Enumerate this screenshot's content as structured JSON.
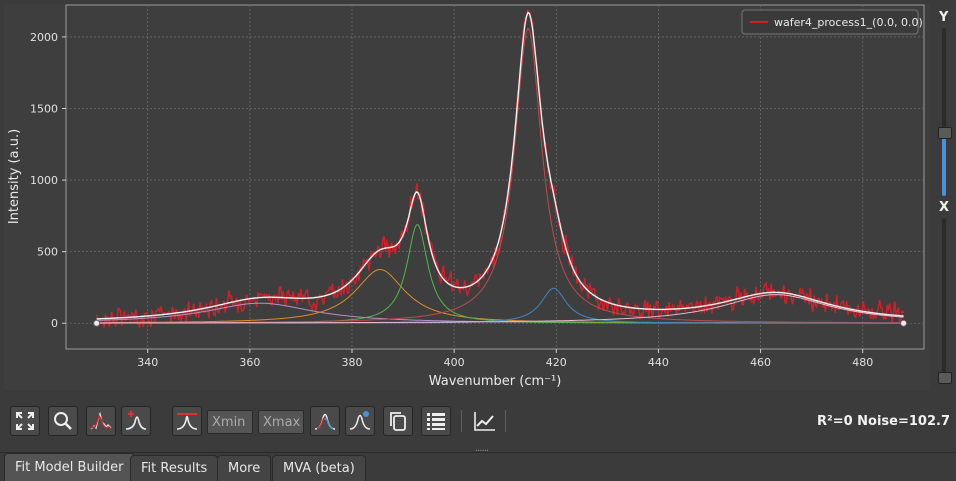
{
  "chart_data": {
    "type": "line",
    "xlabel": "Wavenumber (cm⁻¹)",
    "ylabel": "Intensity (a.u.)",
    "xlim": [
      324,
      492
    ],
    "ylim": [
      -180,
      2230
    ],
    "xticks": [
      340,
      360,
      380,
      400,
      420,
      440,
      460,
      480
    ],
    "yticks": [
      0,
      500,
      1000,
      1500,
      2000
    ],
    "grid": true,
    "legend_position": "top-right",
    "background": "#3e3e3e",
    "x_range": [
      330,
      488
    ],
    "baseline_points": [
      [
        330,
        0
      ],
      [
        488,
        0
      ]
    ],
    "measured": {
      "name": "wafer4_process1_(0.0, 0.0)",
      "color": "#d0202a",
      "noise_amplitude": 102.7
    },
    "components": [
      {
        "shape": "lorentzian",
        "center": 362,
        "amplitude": 140,
        "fwhm": 26,
        "color": "#b392c9"
      },
      {
        "shape": "lorentzian",
        "center": 385.5,
        "amplitude": 375,
        "fwhm": 12,
        "color": "#e08a2a"
      },
      {
        "shape": "lorentzian",
        "center": 392.8,
        "amplitude": 690,
        "fwhm": 5,
        "color": "#4cb84c"
      },
      {
        "shape": "lorentzian",
        "center": 414.5,
        "amplitude": 2060,
        "fwhm": 6.5,
        "color": "#c24a4a"
      },
      {
        "shape": "lorentzian",
        "center": 419.5,
        "amplitude": 245,
        "fwhm": 6,
        "color": "#3f86c6"
      },
      {
        "shape": "lorentzian",
        "center": 463,
        "amplitude": 200,
        "fwhm": 26,
        "color": "#e7b7d3"
      }
    ],
    "fit_total_color": "#f2f2f2"
  },
  "slider": {
    "top_label": "Y",
    "bottom_label": "X"
  },
  "toolbar": {
    "xmin_placeholder": "Xmin",
    "xmax_placeholder": "Xmax",
    "stats": "R²=0  Noise=102.7",
    "grip": "......"
  },
  "tabs": [
    "Fit Model Builder",
    "Fit Results",
    "More",
    "MVA (beta)"
  ]
}
